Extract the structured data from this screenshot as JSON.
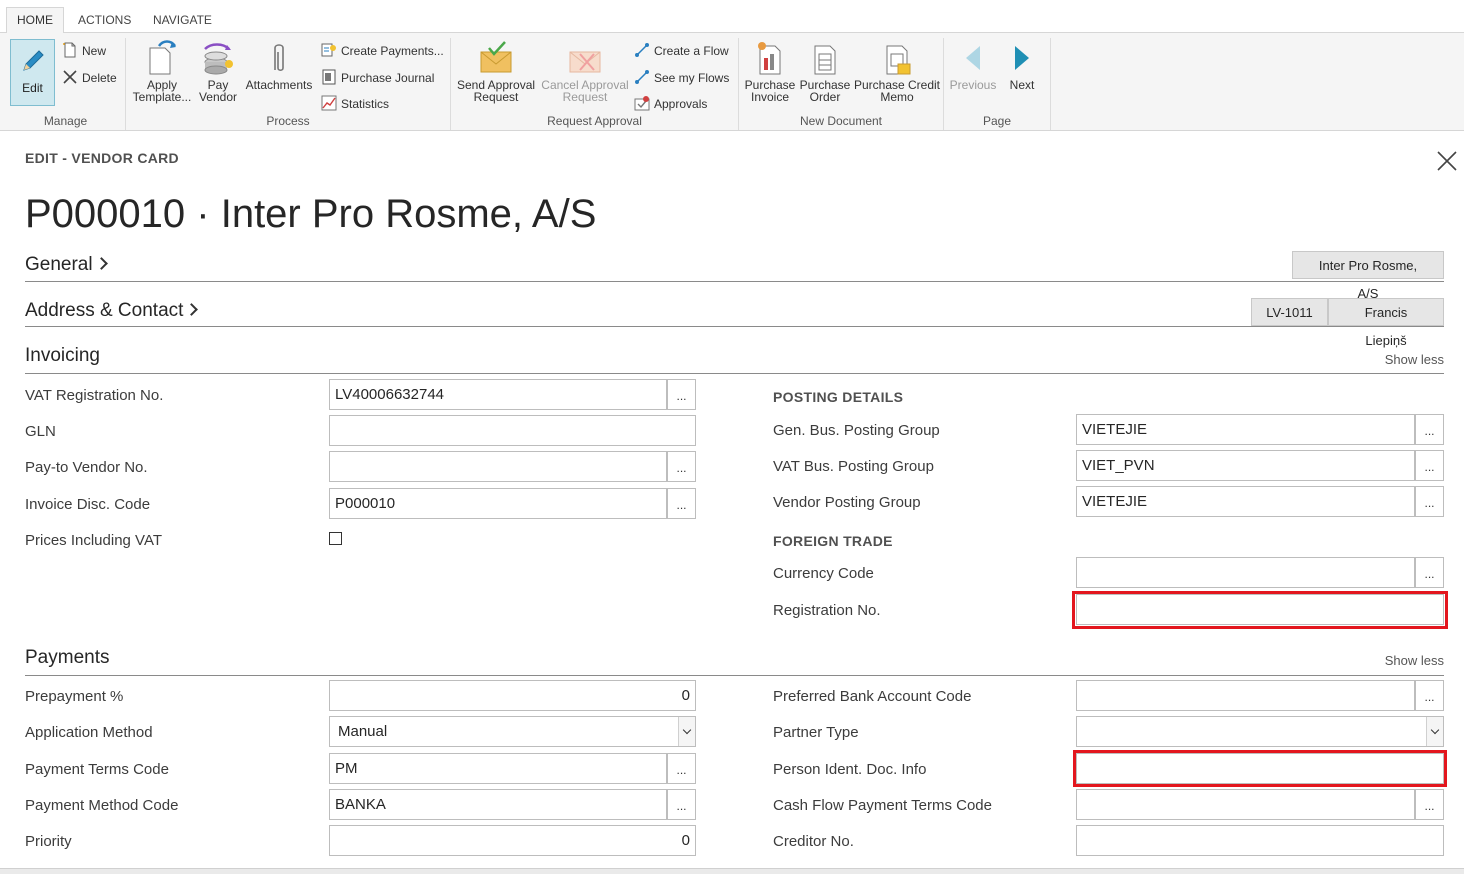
{
  "tabs": [
    "HOME",
    "ACTIONS",
    "NAVIGATE"
  ],
  "ribbon": {
    "manage": {
      "label": "Manage",
      "edit": "Edit",
      "new": "New",
      "delete": "Delete"
    },
    "process": {
      "label": "Process",
      "apply_template_1": "Apply",
      "apply_template_2": "Template...",
      "pay_vendor_1": "Pay",
      "pay_vendor_2": "Vendor",
      "attachments": "Attachments",
      "create_payments": "Create Payments...",
      "purchase_journal": "Purchase Journal",
      "statistics": "Statistics"
    },
    "request_approval": {
      "label": "Request Approval",
      "send_1": "Send Approval",
      "send_2": "Request",
      "cancel_1": "Cancel Approval",
      "cancel_2": "Request",
      "create_flow": "Create a Flow",
      "see_flows": "See my Flows",
      "approvals": "Approvals"
    },
    "new_document": {
      "label": "New Document",
      "pi_1": "Purchase",
      "pi_2": "Invoice",
      "po_1": "Purchase",
      "po_2": "Order",
      "pcm_1": "Purchase Credit",
      "pcm_2": "Memo"
    },
    "page": {
      "label": "Page",
      "previous": "Previous",
      "next": "Next"
    }
  },
  "header": {
    "kicker": "EDIT - VENDOR CARD",
    "title": "P000010 · Inter Pro Rosme, A/S"
  },
  "general": {
    "title": "General",
    "summary": "Inter Pro Rosme, A/S"
  },
  "address": {
    "title": "Address & Contact",
    "summary_1": "LV-1011",
    "summary_2": "Francis Liepiņš"
  },
  "invoicing": {
    "title": "Invoicing",
    "show_less": "Show less",
    "vat_reg_label": "VAT Registration No.",
    "vat_reg_value": "LV40006632744",
    "gln_label": "GLN",
    "gln_value": "",
    "pay_to_label": "Pay-to Vendor No.",
    "pay_to_value": "",
    "inv_disc_label": "Invoice Disc. Code",
    "inv_disc_value": "P000010",
    "prices_vat_label": "Prices Including VAT",
    "posting_head": "POSTING DETAILS",
    "gen_bus_label": "Gen. Bus. Posting Group",
    "gen_bus_value": "VIETEJIE",
    "vat_bus_label": "VAT Bus. Posting Group",
    "vat_bus_value": "VIET_PVN",
    "vendor_posting_label": "Vendor Posting Group",
    "vendor_posting_value": "VIETEJIE",
    "foreign_head": "FOREIGN TRADE",
    "currency_label": "Currency Code",
    "currency_value": "",
    "reg_no_label": "Registration No.",
    "reg_no_value": ""
  },
  "payments": {
    "title": "Payments",
    "show_less": "Show less",
    "prepayment_label": "Prepayment %",
    "prepayment_value": "0",
    "app_method_label": "Application Method",
    "app_method_value": "Manual",
    "terms_label": "Payment Terms Code",
    "terms_value": "PM",
    "method_label": "Payment Method Code",
    "method_value": "BANKA",
    "priority_label": "Priority",
    "priority_value": "0",
    "pref_bank_label": "Preferred Bank Account Code",
    "pref_bank_value": "",
    "partner_label": "Partner Type",
    "partner_value": "",
    "person_ident_label": "Person Ident. Doc. Info",
    "person_ident_value": "",
    "cash_flow_label": "Cash Flow Payment Terms Code",
    "cash_flow_value": "",
    "creditor_label": "Creditor No.",
    "creditor_value": ""
  },
  "colors": {
    "accent": "#0e8fb1",
    "highlight": "#e3161e"
  }
}
